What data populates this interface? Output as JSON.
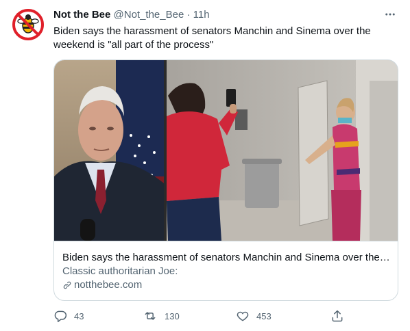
{
  "tweet": {
    "author_name": "Not the Bee",
    "handle": "@Not_the_Bee",
    "separator": "·",
    "time": "11h",
    "text": "Biden says the harassment of senators Manchin and Sinema over the weekend is \"all part of the process\"",
    "more_icon": "more-horizontal-icon"
  },
  "card": {
    "title": "Biden says the harassment of senators Manchin and Sinema over the weekend is \"all part of the process\"",
    "description": "Classic authoritarian Joe:",
    "domain": "notthebee.com",
    "link_icon": "link-icon"
  },
  "actions": {
    "reply_count": "43",
    "retweet_count": "130",
    "like_count": "453"
  },
  "colors": {
    "brand_red": "#e0202a",
    "bee_yellow": "#f2b705",
    "text_primary": "#0f1419",
    "text_secondary": "#536471",
    "border": "#cfd9de"
  }
}
